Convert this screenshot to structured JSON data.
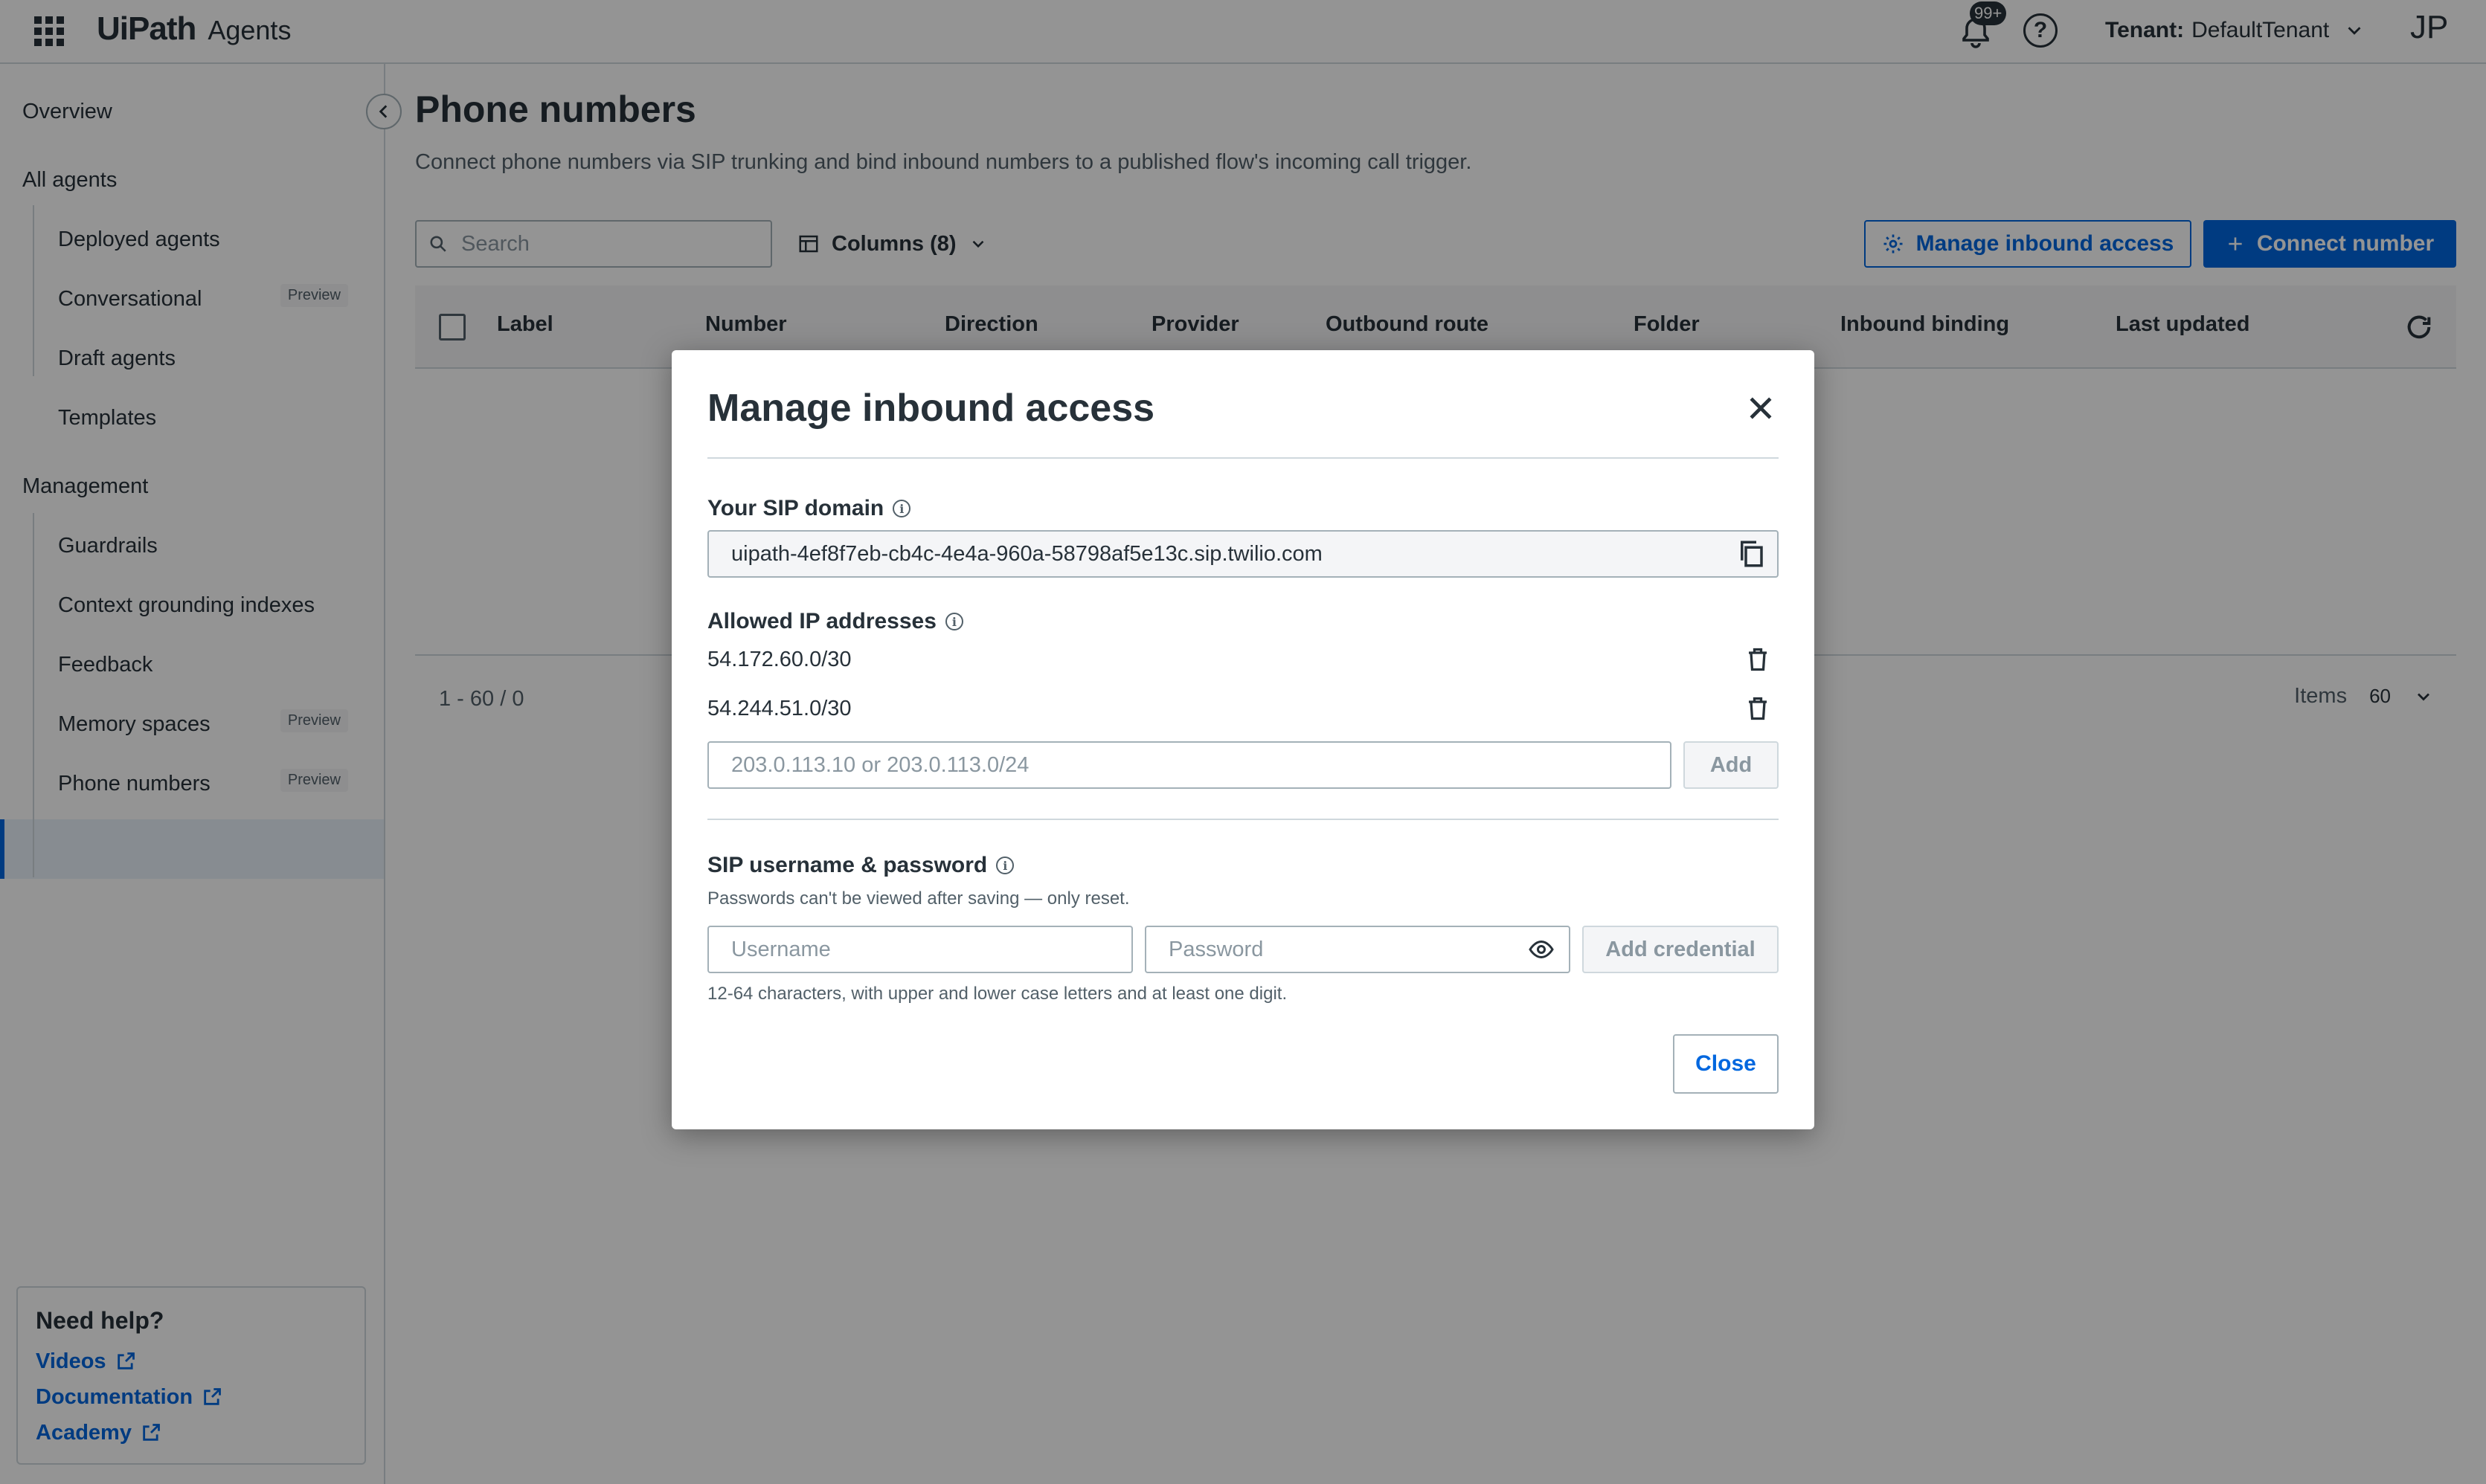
{
  "header": {
    "brand": "UiPath",
    "product": "Agents",
    "notification_count": "99+",
    "help_glyph": "?",
    "tenant_label": "Tenant:",
    "tenant_value": "DefaultTenant",
    "user_initials": "JP"
  },
  "sidebar": {
    "overview": "Overview",
    "all_agents": "All agents",
    "agents_items": [
      {
        "label": "Deployed agents",
        "badge": ""
      },
      {
        "label": "Conversational",
        "badge": "Preview"
      },
      {
        "label": "Draft agents",
        "badge": ""
      },
      {
        "label": "Templates",
        "badge": ""
      }
    ],
    "management": "Management",
    "management_items": [
      {
        "label": "Guardrails",
        "badge": ""
      },
      {
        "label": "Context grounding indexes",
        "badge": ""
      },
      {
        "label": "Feedback",
        "badge": ""
      },
      {
        "label": "Memory spaces",
        "badge": "Preview"
      },
      {
        "label": "Phone numbers",
        "badge": "Preview"
      }
    ],
    "active_item": "Phone numbers",
    "help": {
      "title": "Need help?",
      "links": [
        "Videos",
        "Documentation",
        "Academy"
      ]
    }
  },
  "main": {
    "title": "Phone numbers",
    "subtitle": "Connect phone numbers via SIP trunking and bind inbound numbers to a published flow's incoming call trigger.",
    "search_placeholder": "Search",
    "columns_label": "Columns (8)",
    "manage_button": "Manage inbound access",
    "connect_button": "Connect number",
    "table_columns": [
      "Label",
      "Number",
      "Direction",
      "Provider",
      "Outbound route",
      "Folder",
      "Inbound binding",
      "Last updated"
    ],
    "range": "1 - 60 / 0",
    "items_label": "Items",
    "items_value": "60"
  },
  "modal": {
    "title": "Manage inbound access",
    "sip_domain_label": "Your SIP domain",
    "sip_domain_value": "uipath-4ef8f7eb-cb4c-4e4a-960a-58798af5e13c.sip.twilio.com",
    "allowed_ip_label": "Allowed IP addresses",
    "ip_addresses": [
      "54.172.60.0/30",
      "54.244.51.0/30"
    ],
    "ip_placeholder": "203.0.113.10 or 203.0.113.0/24",
    "add_button": "Add",
    "credentials_label": "SIP username & password",
    "credentials_note": "Passwords can't be viewed after saving — only reset.",
    "username_placeholder": "Username",
    "password_placeholder": "Password",
    "add_credential_button": "Add credential",
    "password_hint": "12-64 characters, with upper and lower case letters and at least one digit.",
    "close_button": "Close"
  },
  "colors": {
    "accent": "#0067df",
    "text": "#273139",
    "muted": "#526069",
    "border": "#cfd8dd"
  }
}
